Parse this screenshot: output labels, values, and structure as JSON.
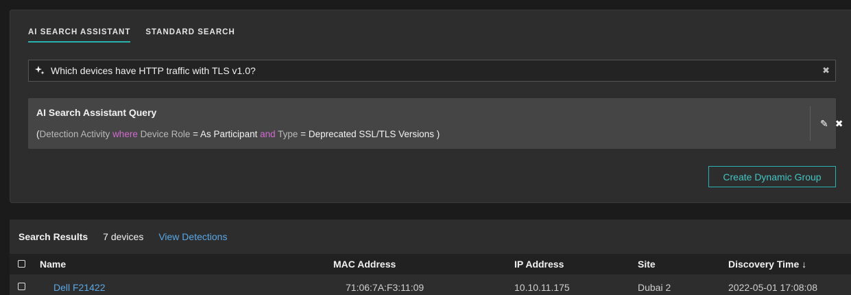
{
  "tabs": [
    {
      "label": "AI SEARCH ASSISTANT",
      "active": true
    },
    {
      "label": "STANDARD SEARCH",
      "active": false
    }
  ],
  "search": {
    "value": "Which devices have HTTP traffic with TLS v1.0?",
    "icon": "sparkle-icon",
    "clear_icon": "close-icon"
  },
  "query": {
    "title": "AI Search Assistant Query",
    "open_paren": "(",
    "field1": "Detection Activity",
    "kw_where": "where",
    "field2": "Device Role",
    "eq1": "= As Participant",
    "kw_and": "and",
    "field3": "Type",
    "eq2": "= Deprecated SSL/TLS Versions )",
    "edit_icon": "pencil-icon",
    "remove_icon": "close-icon"
  },
  "create_group_label": "Create Dynamic Group",
  "results": {
    "label": "Search Results",
    "count": "7 devices",
    "view_link": "View Detections"
  },
  "table": {
    "columns": [
      "Name",
      "MAC Address",
      "IP Address",
      "Site",
      "Discovery Time ↓"
    ],
    "first_row_partial": [
      "Dell F21422",
      "71:06:7A:F3:11:09",
      "10.10.11.175",
      "Dubai 2",
      "2022-05-01 17:08:08"
    ]
  },
  "colors": {
    "accent": "#2ab3b1",
    "link": "#5aa8e6",
    "keyword": "#d06ad0",
    "panel": "#2d2d2d",
    "background": "#1b1b1b"
  }
}
